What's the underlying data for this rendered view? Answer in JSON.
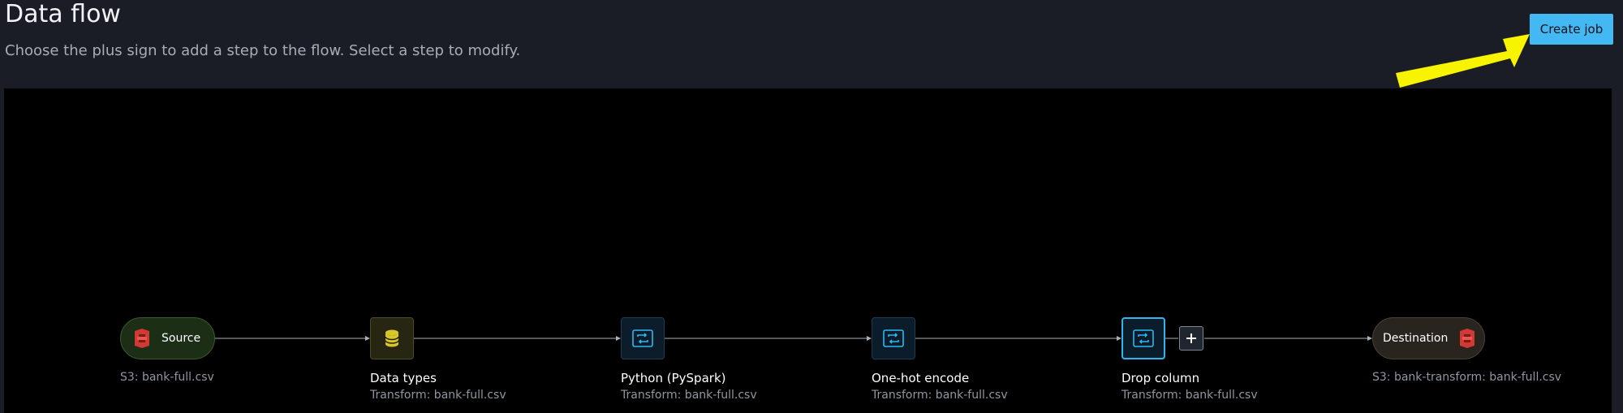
{
  "header": {
    "title": "Data flow",
    "subtitle": "Choose the plus sign to add a step to the flow. Select a step to modify.",
    "create_job_label": "Create job"
  },
  "colors": {
    "background": "#1b1d26",
    "canvas": "#000000",
    "accent": "#43b8f3",
    "annotation_arrow": "#f8f400"
  },
  "flow": {
    "source": {
      "label": "Source",
      "icon": "s3-bucket-icon",
      "detail": "S3: bank-full.csv"
    },
    "steps": [
      {
        "title": "Data types",
        "icon": "database-icon",
        "detail": "Transform: bank-full.csv"
      },
      {
        "title": "Python (PySpark)",
        "icon": "transform-icon",
        "detail": "Transform: bank-full.csv"
      },
      {
        "title": "One-hot encode",
        "icon": "transform-icon",
        "detail": "Transform: bank-full.csv"
      },
      {
        "title": "Drop column",
        "icon": "transform-icon",
        "detail": "Transform: bank-full.csv",
        "selected": true
      }
    ],
    "add_step_icon": "plus-icon",
    "destination": {
      "label": "Destination",
      "icon": "s3-bucket-icon",
      "detail": "S3: bank-transform: bank-full.csv"
    }
  }
}
